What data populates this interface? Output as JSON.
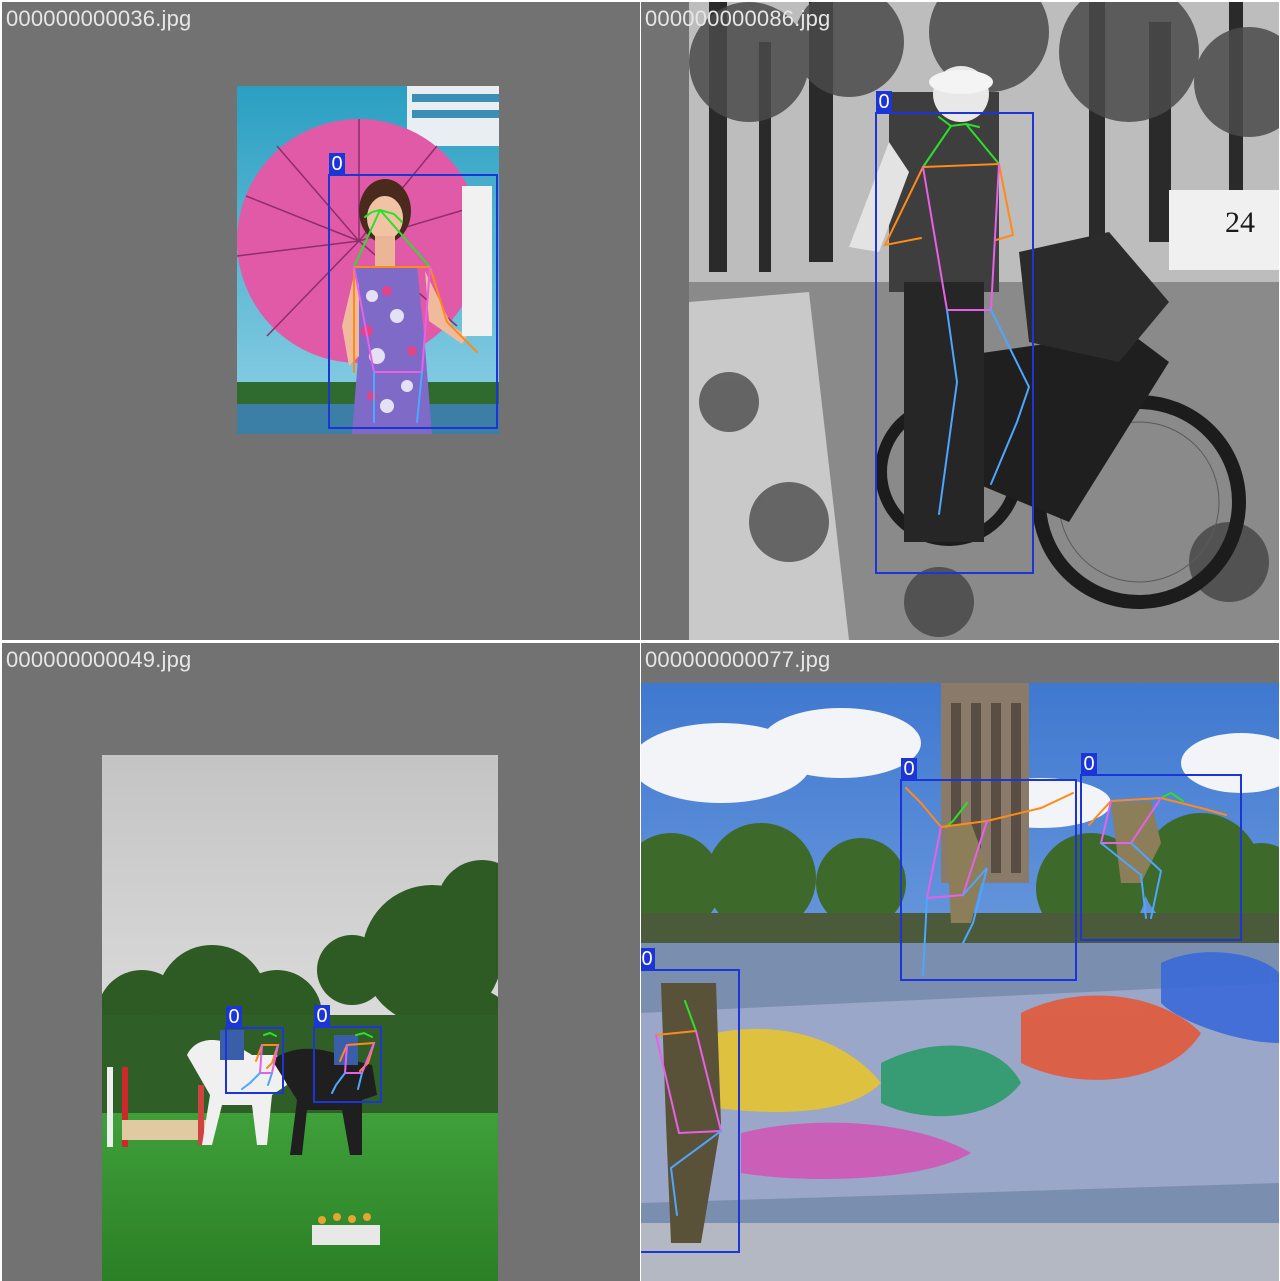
{
  "colors": {
    "box": "#1c35d6",
    "face": "#2be02b",
    "arms": "#ff8a18",
    "torso": "#e860e8",
    "legs": "#4da6ff",
    "letterbox": "#727272"
  },
  "tiles": [
    {
      "filename": "000000000036.jpg",
      "detections": [
        {
          "class_label": "0"
        }
      ]
    },
    {
      "filename": "000000000086.jpg",
      "detections": [
        {
          "class_label": "0"
        }
      ]
    },
    {
      "filename": "000000000049.jpg",
      "detections": [
        {
          "class_label": "0"
        },
        {
          "class_label": "0"
        }
      ]
    },
    {
      "filename": "000000000077.jpg",
      "detections": [
        {
          "class_label": "0"
        },
        {
          "class_label": "0"
        },
        {
          "class_label": "0"
        }
      ]
    }
  ],
  "photo_texts": {
    "sign_number": "24"
  }
}
